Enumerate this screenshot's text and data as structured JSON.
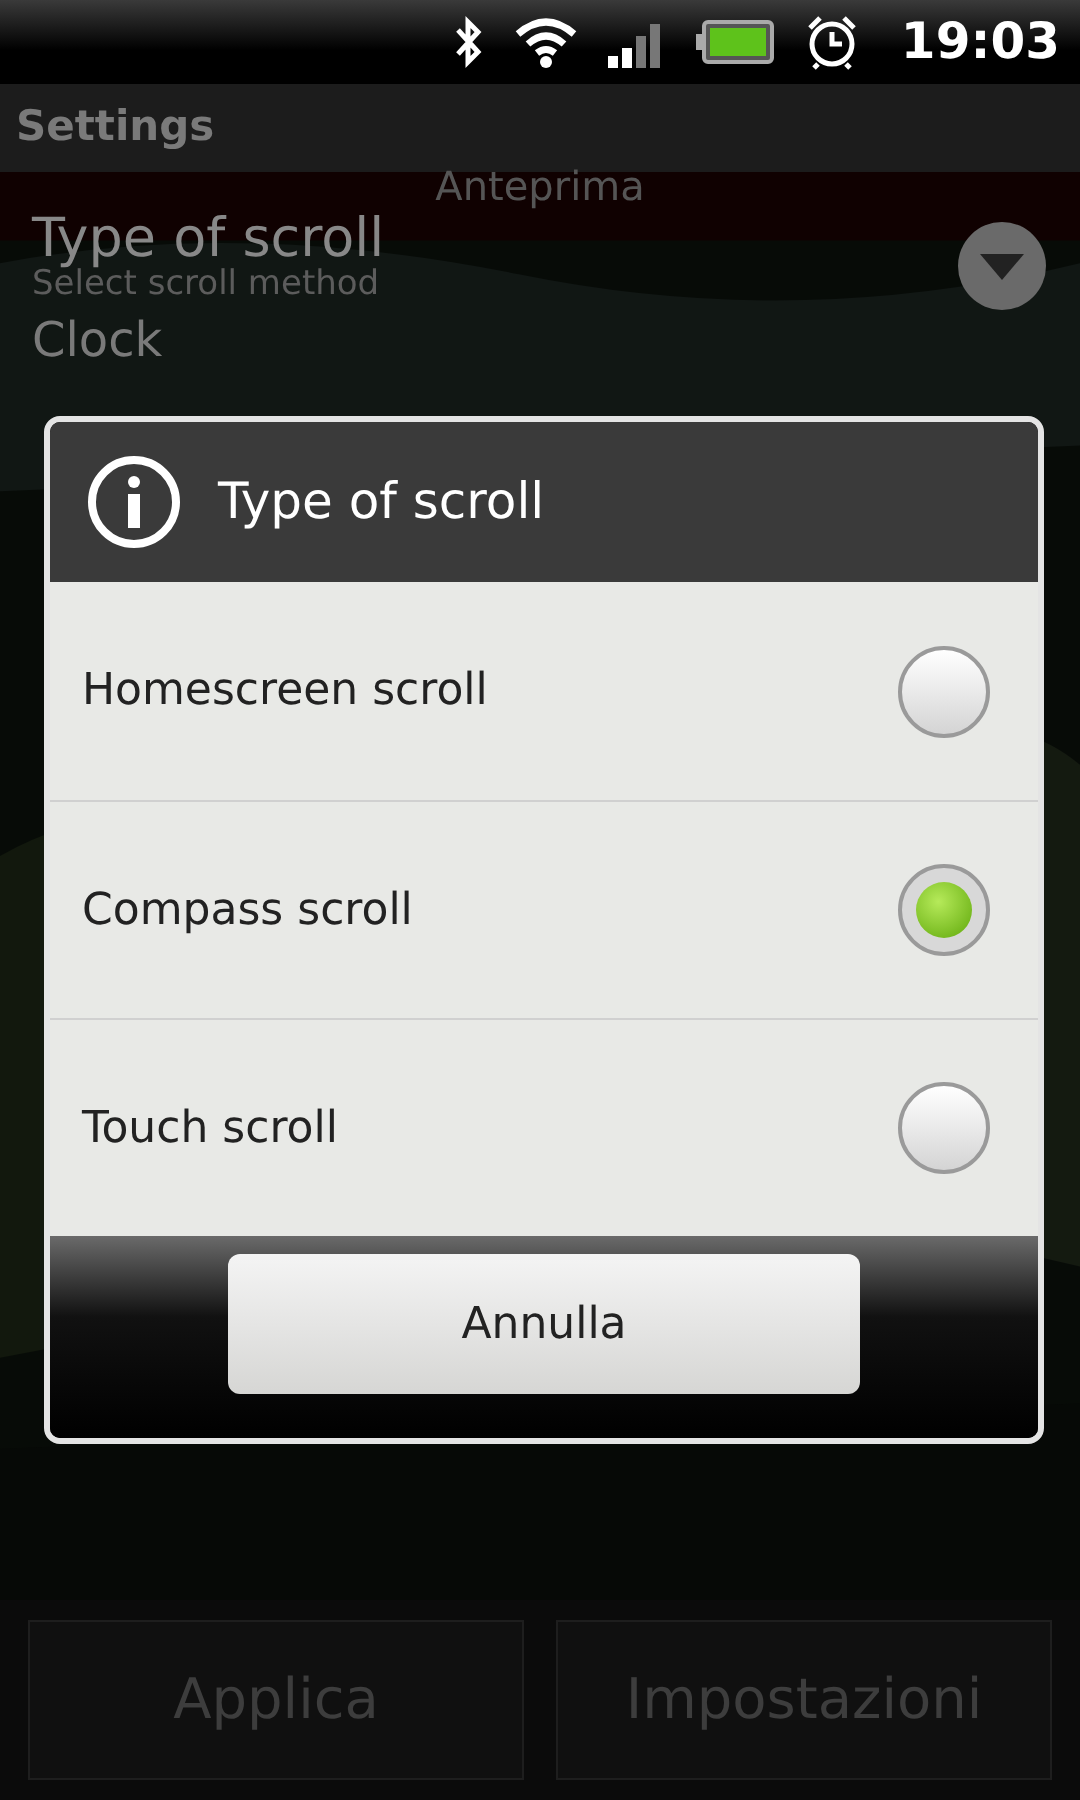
{
  "status_bar": {
    "time": "19:03"
  },
  "title_bar": {
    "title": "Settings"
  },
  "background": {
    "preview_label": "Anteprima",
    "setting_title": "Type of scroll",
    "setting_summary": "Select scroll method",
    "clock_label": "Clock"
  },
  "bottom_buttons": [
    "Applica",
    "Impostazioni"
  ],
  "dialog": {
    "title": "Type of scroll",
    "options": [
      {
        "label": "Homescreen scroll",
        "selected": false
      },
      {
        "label": "Compass scroll",
        "selected": true
      },
      {
        "label": "Touch scroll",
        "selected": false
      }
    ],
    "cancel": "Annulla"
  }
}
